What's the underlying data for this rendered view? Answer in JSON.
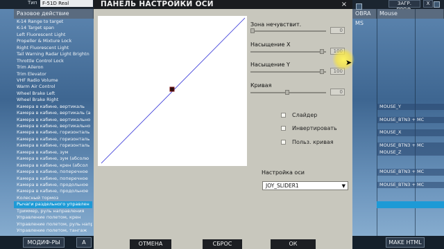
{
  "background": {
    "type_label": "Тип",
    "type_value": "F-51D Real",
    "top_buttons": [
      "ЗАГР. ПРОФ.",
      "Х"
    ],
    "headers": [
      "Разовое действие",
      "OBRA MS",
      "Mouse"
    ],
    "actions": [
      "K-14 Range to target",
      "K-14 Target span",
      "Left Fluorescent Light",
      "Propeller & Mixture Lock",
      "Right Fluorescent Light",
      "Tail Warning Radar Light Brightn",
      "Throttle Control Lock",
      "Trim Aileron",
      "Trim Elevator",
      "VHF Radio Volume",
      "Warm Air Control",
      "Wheel Brake Left",
      "Wheel Brake Right",
      "Камера в кабине, вертикаль",
      "Камера в кабине, вертикаль (а",
      "Камера в кабине, вертикально",
      "Камера в кабине, вертикально",
      "Камера в кабине, горизонталь",
      "Камера в кабине, горизонталь",
      "Камера в кабине, горизонталь",
      "Камера в кабине, зум",
      "Камера в кабине, зум (абсолю",
      "Камера в кабине, крен (абсол",
      "Камера в кабине, поперечное",
      "Камера в кабине, поперечное",
      "Камера в кабине, продольное",
      "Камера в кабине, продольное",
      "Колесный тормоз",
      "Рычаги раздельного управлен",
      "Триммер, руль направления",
      "Управление полетом, крен",
      "Управление полетом, руль напр",
      "Управление полетом, тангаж"
    ],
    "mouse_col": [
      "",
      "",
      "",
      "",
      "",
      "",
      "",
      "",
      "",
      "",
      "",
      "",
      "",
      "MOUSE_Y",
      "",
      "MOUSE_BTN3 + MC",
      "",
      "MOUSE_X",
      "",
      "MOUSE_BTN3 + MC",
      "MOUSE_Z",
      "",
      "",
      "MOUSE_BTN3 + MC",
      "",
      "MOUSE_BTN3 + MC",
      "",
      "",
      "",
      "",
      "",
      "",
      ""
    ],
    "selected_index": 28,
    "bottom_buttons": [
      "МОДИФ-РЫ",
      "А",
      "MAKE HTML"
    ]
  },
  "dialog": {
    "title": "ПАНЕЛЬ НАСТРОЙКИ ОСИ",
    "close": "×",
    "sliders": [
      {
        "label": "Зона нечувствит.",
        "value": "0",
        "level": 0.0
      },
      {
        "label": "Насыщение X",
        "value": "100",
        "level": 1.0
      },
      {
        "label": "Насыщение Y",
        "value": "100",
        "level": 1.0
      },
      {
        "label": "Кривая",
        "value": "0",
        "level": 0.5
      }
    ],
    "checkboxes": [
      {
        "label": "Слайдер",
        "checked": false
      },
      {
        "label": "Инвертировать",
        "checked": false
      },
      {
        "label": "Польз. кривая",
        "checked": false
      }
    ],
    "axis_label": "Настройка оси",
    "axis_value": "JOY_SLIDER1",
    "buttons": [
      "ОТМЕНА",
      "СБРОС",
      "ОК"
    ],
    "curve_marker": 0.5
  }
}
